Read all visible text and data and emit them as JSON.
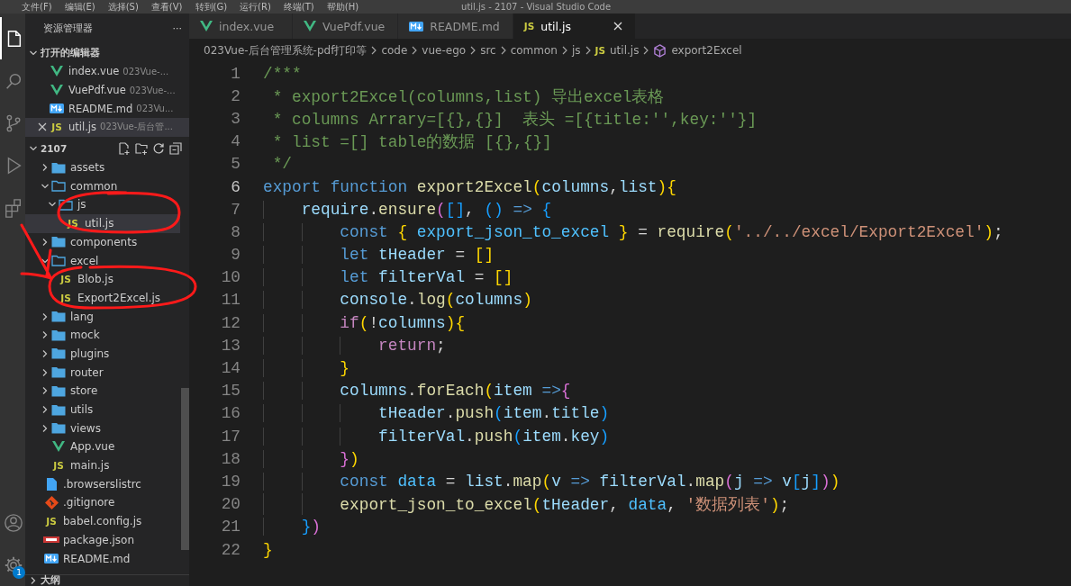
{
  "menu_bar": {
    "items": [
      "文件(F)",
      "编辑(E)",
      "选择(S)",
      "查看(V)",
      "转到(G)",
      "运行(R)",
      "终端(T)",
      "帮助(H)"
    ],
    "title": "util.js - 2107 - Visual Studio Code"
  },
  "activity_bar": [
    {
      "kind": "explorer",
      "selected": true
    },
    {
      "kind": "search",
      "selected": false
    },
    {
      "kind": "source-control",
      "selected": false
    },
    {
      "kind": "run",
      "selected": false
    },
    {
      "kind": "extensions",
      "selected": false
    },
    {
      "kind": "account",
      "selected": false
    },
    {
      "kind": "settings",
      "selected": false,
      "badge": "1"
    }
  ],
  "sidebar": {
    "title": "资源管理器",
    "more": "···",
    "open_editors": {
      "title": "打开的编辑器",
      "expanded": true,
      "items": [
        {
          "label": "index.vue",
          "description": "023Vue-...",
          "kind": "vue",
          "selected": false
        },
        {
          "label": "VuePdf.vue",
          "description": "023Vue-...",
          "kind": "vue",
          "selected": false
        },
        {
          "label": "README.md",
          "description": "023Vu...",
          "kind": "md",
          "selected": false
        },
        {
          "label": "util.js",
          "description": "023Vue-后台管...",
          "kind": "js",
          "badge": "JS",
          "selected": true
        }
      ]
    },
    "folder": {
      "title": "2107",
      "expanded": true,
      "tree": [
        {
          "children": [
            {
              "label": "assets",
              "kind": "folder",
              "expanded": false,
              "selected": false
            },
            {
              "label": "common",
              "kind": "folder",
              "expanded": true,
              "selected": false,
              "children": [
                {
                  "label": "js",
                  "kind": "folder",
                  "expanded": true,
                  "selected": false,
                  "children": [
                    {
                      "label": "util.js",
                      "kind": "js",
                      "badge": "JS",
                      "selected": true
                    }
                  ]
                }
              ]
            },
            {
              "label": "components",
              "kind": "folder",
              "expanded": false,
              "selected": false
            },
            {
              "label": "excel",
              "kind": "folder",
              "expanded": true,
              "selected": false,
              "children": [
                {
                  "label": "Blob.js",
                  "kind": "js",
                  "badge": "JS",
                  "selected": false
                },
                {
                  "label": "Export2Excel.js",
                  "kind": "js",
                  "badge": "JS",
                  "selected": false
                }
              ]
            },
            {
              "label": "lang",
              "kind": "folder",
              "expanded": false,
              "selected": false
            },
            {
              "label": "mock",
              "kind": "folder",
              "expanded": false,
              "selected": false
            },
            {
              "label": "plugins",
              "kind": "folder",
              "expanded": false,
              "selected": false
            },
            {
              "label": "router",
              "kind": "folder",
              "expanded": false,
              "selected": false
            },
            {
              "label": "store",
              "kind": "folder",
              "expanded": false,
              "selected": false
            },
            {
              "label": "utils",
              "kind": "folder",
              "expanded": false,
              "selected": false
            },
            {
              "label": "views",
              "kind": "folder",
              "expanded": false,
              "selected": false
            },
            {
              "label": "App.vue",
              "kind": "vue",
              "selected": false
            },
            {
              "label": "main.js",
              "kind": "js",
              "badge": "JS",
              "selected": false
            }
          ]
        },
        {
          "label": ".browserslistrc",
          "kind": "file",
          "selected": false
        },
        {
          "label": ".gitignore",
          "kind": "git",
          "selected": false
        },
        {
          "label": "babel.config.js",
          "kind": "js",
          "badge": "JS",
          "selected": false
        },
        {
          "label": "package.json",
          "kind": "npm",
          "selected": false
        },
        {
          "label": "README.md",
          "kind": "md",
          "selected": false
        }
      ]
    },
    "outline": {
      "title": "大纲",
      "expanded": false
    }
  },
  "tabs": [
    {
      "label": "index.vue",
      "kind": "vue",
      "selected": false
    },
    {
      "label": "VuePdf.vue",
      "kind": "vue",
      "selected": false
    },
    {
      "label": "README.md",
      "kind": "md",
      "selected": false
    },
    {
      "label": "util.js",
      "kind": "js",
      "badge": "JS",
      "selected": true
    }
  ],
  "breadcrumb": [
    {
      "text": "023Vue-后台管理系统-pdf打印等"
    },
    {
      "text": "code"
    },
    {
      "text": "vue-ego"
    },
    {
      "text": "src"
    },
    {
      "text": "common"
    },
    {
      "text": "js"
    },
    {
      "text": "util.js",
      "kind": "js",
      "badge": "JS"
    },
    {
      "text": "export2Excel",
      "kind": "symbol"
    }
  ],
  "editor": {
    "lines": [
      {
        "number": "1",
        "current": false,
        "tokens": [
          {
            "text": "/***",
            "kind": "comment"
          }
        ]
      },
      {
        "number": "2",
        "current": false,
        "tokens": [
          {
            "text": " * export2Excel(columns,list) 导出excel表格",
            "kind": "comment"
          }
        ]
      },
      {
        "number": "3",
        "current": false,
        "tokens": [
          {
            "text": " * columns Arrary=[{},{}]  表头 =[{title:'',key:''}]",
            "kind": "comment"
          }
        ]
      },
      {
        "number": "4",
        "current": false,
        "tokens": [
          {
            "text": " * list =[] table的数据 [{},{}]",
            "kind": "comment"
          }
        ]
      },
      {
        "number": "5",
        "current": false,
        "tokens": [
          {
            "text": " */",
            "kind": "comment"
          }
        ]
      },
      {
        "number": "6",
        "current": true,
        "tokens": [
          {
            "text": "export",
            "kind": "keyword"
          },
          {
            "text": " function",
            "kind": "keyword"
          },
          {
            "text": " export2Excel",
            "kind": "function"
          },
          {
            "text": "(",
            "kind": "bracket1"
          },
          {
            "text": "columns",
            "kind": "variable"
          },
          {
            "text": ",",
            "kind": "plain"
          },
          {
            "text": "list",
            "kind": "variable"
          },
          {
            "text": ")",
            "kind": "bracket1"
          },
          {
            "text": "{",
            "kind": "bracket1"
          }
        ]
      },
      {
        "number": "7",
        "current": false,
        "tokens": [
          {
            "text": "    require",
            "kind": "variable"
          },
          {
            "text": ".",
            "kind": "plain"
          },
          {
            "text": "ensure",
            "kind": "function"
          },
          {
            "text": "(",
            "kind": "bracket2"
          },
          {
            "text": "[]",
            "kind": "bracket3"
          },
          {
            "text": ",",
            "kind": "plain"
          },
          {
            "text": " ()",
            "kind": "bracket3"
          },
          {
            "text": " =>",
            "kind": "keyword"
          },
          {
            "text": " {",
            "kind": "bracket3"
          }
        ]
      },
      {
        "number": "8",
        "current": false,
        "tokens": [
          {
            "text": "        const",
            "kind": "keyword"
          },
          {
            "text": " {",
            "kind": "bracket1"
          },
          {
            "text": " export_json_to_excel",
            "kind": "constant"
          },
          {
            "text": " }",
            "kind": "bracket1"
          },
          {
            "text": " =",
            "kind": "plain"
          },
          {
            "text": " require",
            "kind": "function"
          },
          {
            "text": "(",
            "kind": "bracket1"
          },
          {
            "text": "'../../excel/Export2Excel'",
            "kind": "string"
          },
          {
            "text": ")",
            "kind": "bracket1"
          },
          {
            "text": ";",
            "kind": "plain"
          }
        ]
      },
      {
        "number": "9",
        "current": false,
        "tokens": [
          {
            "text": "        let",
            "kind": "keyword"
          },
          {
            "text": " tHeader",
            "kind": "variable"
          },
          {
            "text": " =",
            "kind": "plain"
          },
          {
            "text": " []",
            "kind": "bracket1"
          }
        ]
      },
      {
        "number": "10",
        "current": false,
        "tokens": [
          {
            "text": "        let",
            "kind": "keyword"
          },
          {
            "text": " filterVal",
            "kind": "variable"
          },
          {
            "text": " =",
            "kind": "plain"
          },
          {
            "text": " []",
            "kind": "bracket1"
          }
        ]
      },
      {
        "number": "11",
        "current": false,
        "tokens": [
          {
            "text": "        console",
            "kind": "variable"
          },
          {
            "text": ".",
            "kind": "plain"
          },
          {
            "text": "log",
            "kind": "function"
          },
          {
            "text": "(",
            "kind": "bracket1"
          },
          {
            "text": "columns",
            "kind": "variable"
          },
          {
            "text": ")",
            "kind": "bracket1"
          }
        ]
      },
      {
        "number": "12",
        "current": false,
        "tokens": [
          {
            "text": "        if",
            "kind": "control"
          },
          {
            "text": "(",
            "kind": "bracket1"
          },
          {
            "text": "!",
            "kind": "plain"
          },
          {
            "text": "columns",
            "kind": "variable"
          },
          {
            "text": ")",
            "kind": "bracket1"
          },
          {
            "text": "{",
            "kind": "bracket1"
          }
        ]
      },
      {
        "number": "13",
        "current": false,
        "tokens": [
          {
            "text": "            return",
            "kind": "control"
          },
          {
            "text": ";",
            "kind": "plain"
          }
        ]
      },
      {
        "number": "14",
        "current": false,
        "tokens": [
          {
            "text": "        }",
            "kind": "bracket1"
          }
        ]
      },
      {
        "number": "15",
        "current": false,
        "tokens": [
          {
            "text": "        columns",
            "kind": "variable"
          },
          {
            "text": ".",
            "kind": "plain"
          },
          {
            "text": "forEach",
            "kind": "function"
          },
          {
            "text": "(",
            "kind": "bracket1"
          },
          {
            "text": "item",
            "kind": "variable"
          },
          {
            "text": " =>",
            "kind": "keyword"
          },
          {
            "text": "{",
            "kind": "bracket2"
          }
        ]
      },
      {
        "number": "16",
        "current": false,
        "tokens": [
          {
            "text": "            tHeader",
            "kind": "variable"
          },
          {
            "text": ".",
            "kind": "plain"
          },
          {
            "text": "push",
            "kind": "function"
          },
          {
            "text": "(",
            "kind": "bracket3"
          },
          {
            "text": "item",
            "kind": "variable"
          },
          {
            "text": ".",
            "kind": "plain"
          },
          {
            "text": "title",
            "kind": "variable"
          },
          {
            "text": ")",
            "kind": "bracket3"
          }
        ]
      },
      {
        "number": "17",
        "current": false,
        "tokens": [
          {
            "text": "            filterVal",
            "kind": "variable"
          },
          {
            "text": ".",
            "kind": "plain"
          },
          {
            "text": "push",
            "kind": "function"
          },
          {
            "text": "(",
            "kind": "bracket3"
          },
          {
            "text": "item",
            "kind": "variable"
          },
          {
            "text": ".",
            "kind": "plain"
          },
          {
            "text": "key",
            "kind": "variable"
          },
          {
            "text": ")",
            "kind": "bracket3"
          }
        ]
      },
      {
        "number": "18",
        "current": false,
        "tokens": [
          {
            "text": "        }",
            "kind": "bracket2"
          },
          {
            "text": ")",
            "kind": "bracket1"
          }
        ]
      },
      {
        "number": "19",
        "current": false,
        "tokens": [
          {
            "text": "        const",
            "kind": "keyword"
          },
          {
            "text": " data",
            "kind": "constant"
          },
          {
            "text": " =",
            "kind": "plain"
          },
          {
            "text": " list",
            "kind": "variable"
          },
          {
            "text": ".",
            "kind": "plain"
          },
          {
            "text": "map",
            "kind": "function"
          },
          {
            "text": "(",
            "kind": "bracket1"
          },
          {
            "text": "v",
            "kind": "variable"
          },
          {
            "text": " =>",
            "kind": "keyword"
          },
          {
            "text": " filterVal",
            "kind": "variable"
          },
          {
            "text": ".",
            "kind": "plain"
          },
          {
            "text": "map",
            "kind": "function"
          },
          {
            "text": "(",
            "kind": "bracket2"
          },
          {
            "text": "j",
            "kind": "variable"
          },
          {
            "text": " =>",
            "kind": "keyword"
          },
          {
            "text": " v",
            "kind": "variable"
          },
          {
            "text": "[",
            "kind": "bracket3"
          },
          {
            "text": "j",
            "kind": "variable"
          },
          {
            "text": "]",
            "kind": "bracket3"
          },
          {
            "text": ")",
            "kind": "bracket2"
          },
          {
            "text": ")",
            "kind": "bracket1"
          }
        ]
      },
      {
        "number": "20",
        "current": false,
        "tokens": [
          {
            "text": "        export_json_to_excel",
            "kind": "function"
          },
          {
            "text": "(",
            "kind": "bracket1"
          },
          {
            "text": "tHeader",
            "kind": "variable"
          },
          {
            "text": ",",
            "kind": "plain"
          },
          {
            "text": " data",
            "kind": "constant"
          },
          {
            "text": ",",
            "kind": "plain"
          },
          {
            "text": " '数据列表'",
            "kind": "string"
          },
          {
            "text": ")",
            "kind": "bracket1"
          },
          {
            "text": ";",
            "kind": "plain"
          }
        ]
      },
      {
        "number": "21",
        "current": false,
        "tokens": [
          {
            "text": "    }",
            "kind": "bracket3"
          },
          {
            "text": ")",
            "kind": "bracket2"
          }
        ]
      },
      {
        "number": "22",
        "current": false,
        "tokens": [
          {
            "text": "}",
            "kind": "bracket1"
          }
        ]
      }
    ]
  }
}
